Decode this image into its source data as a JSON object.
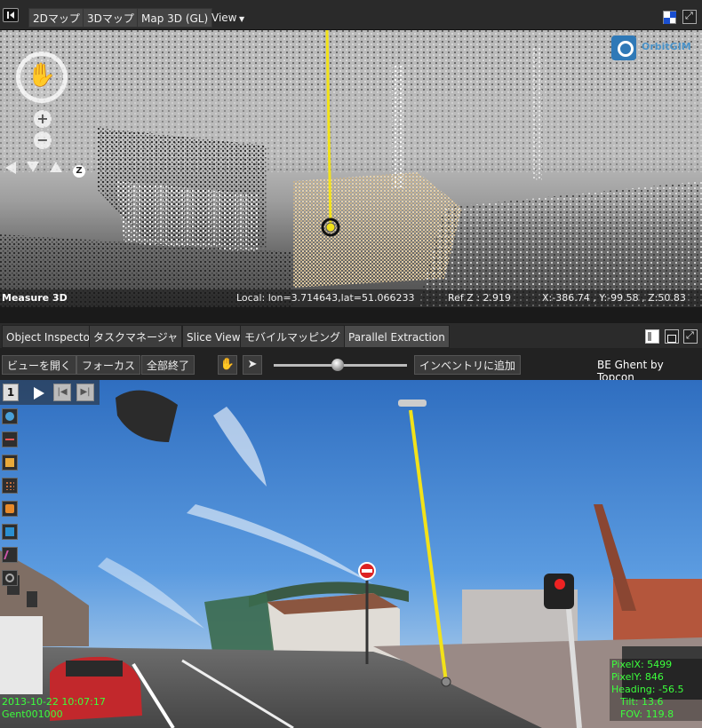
{
  "toolbar": {
    "tabs": [
      "2Dマップ",
      "3Dマップ",
      "Map 3D (GL)"
    ],
    "view_menu": "View"
  },
  "view3d": {
    "logo_text": "OrbitGIM",
    "status": {
      "mode": "Measure 3D",
      "local": "Local: lon=3.714643,lat=51.066233",
      "refz": "Ref Z : 2.919",
      "xyz": "X:-386.74 , Y:-99.58 , Z:50.83"
    },
    "z_label": "Z"
  },
  "panel_tabs": [
    "Object Inspector",
    "タスクマネージャ",
    "Slice View",
    "モバイルマッピング",
    "Parallel Extraction"
  ],
  "image_toolbar": {
    "open_view": "ビューを開く",
    "focus": "フォーカス",
    "close_all": "全部終了",
    "add_inventory": "インベントリに追加",
    "brand": "BE Ghent by Topcon",
    "slider_value": 0.48
  },
  "street": {
    "frame_number": "1",
    "timestamp": "2013-10-22 10:07:17",
    "image_id": "Gent001000",
    "readout": {
      "pixel_x": "PixelX: 5499",
      "pixel_y": "PixelY: 846",
      "heading": "Heading: -56.5",
      "tilt": "Tilt: 13.6",
      "fov": "FOV: 119.8"
    }
  },
  "colors": {
    "measure_line": "#f2e21a",
    "overlay_text": "#3cff3c",
    "sky_top": "#2f6ec0"
  }
}
